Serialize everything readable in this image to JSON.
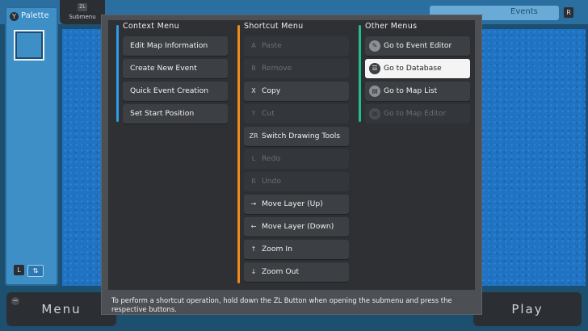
{
  "background": {
    "palette_key": "Y",
    "palette_title": "Palette",
    "submenu_key": "ZL",
    "submenu_label": "Submenu",
    "events_tab": "Events",
    "r_key": "R",
    "l_key": "L",
    "swap_glyph": "⇅",
    "menu_label": "Menu",
    "play_label": "Play",
    "minus_glyph": "−"
  },
  "overlay": {
    "columns": [
      {
        "title": "Context Menu",
        "accent": "#2b9fe6",
        "items": [
          {
            "label": "Edit Map Information",
            "disabled": false
          },
          {
            "label": "Create New Event",
            "disabled": false
          },
          {
            "label": "Quick Event Creation",
            "disabled": false
          },
          {
            "label": "Set Start Position",
            "disabled": false
          }
        ]
      },
      {
        "title": "Shortcut Menu",
        "accent": "#f08a1c",
        "items": [
          {
            "key": "A",
            "label": "Paste",
            "disabled": true
          },
          {
            "key": "B",
            "label": "Remove",
            "disabled": true
          },
          {
            "key": "X",
            "label": "Copy",
            "disabled": false
          },
          {
            "key": "Y",
            "label": "Cut",
            "disabled": true
          },
          {
            "key": "ZR",
            "label": "Switch Drawing Tools",
            "disabled": false
          },
          {
            "key": "L",
            "label": "Redo",
            "disabled": true
          },
          {
            "key": "R",
            "label": "Undo",
            "disabled": true
          },
          {
            "key": "→",
            "label": "Move Layer (Up)",
            "disabled": false
          },
          {
            "key": "←",
            "label": "Move Layer (Down)",
            "disabled": false
          },
          {
            "key": "↑",
            "label": "Zoom In",
            "disabled": false
          },
          {
            "key": "↓",
            "label": "Zoom Out",
            "disabled": false
          }
        ]
      },
      {
        "title": "Other Menus",
        "accent": "#1fbf8f",
        "items": [
          {
            "icon": "event-editor-icon",
            "glyph": "✎",
            "label": "Go to Event Editor",
            "disabled": false,
            "selected": false
          },
          {
            "icon": "database-icon",
            "glyph": "☰",
            "label": "Go to Database",
            "disabled": false,
            "selected": true
          },
          {
            "icon": "map-list-icon",
            "glyph": "▤",
            "label": "Go to Map List",
            "disabled": false,
            "selected": false
          },
          {
            "icon": "map-editor-icon",
            "glyph": "▦",
            "label": "Go to Map Editor",
            "disabled": true,
            "selected": false
          }
        ]
      }
    ],
    "footer_note": "To perform a shortcut operation, hold down the ZL Button when opening the submenu and press the respective buttons."
  }
}
